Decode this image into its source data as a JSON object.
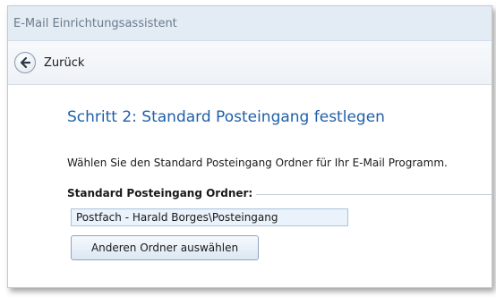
{
  "window": {
    "title": "E-Mail Einrichtungsassistent"
  },
  "nav": {
    "back_label": "Zurück",
    "back_icon": "arrow-left-icon"
  },
  "step": {
    "title": "Schritt 2: Standard Posteingang festlegen",
    "instruction": "Wählen Sie den Standard Posteingang Ordner für Ihr E-Mail Programm."
  },
  "folder_group": {
    "label": "Standard Posteingang Ordner:",
    "value": "Postfach - Harald Borges\\Posteingang",
    "choose_button_label": "Anderen Ordner auswählen"
  },
  "colors": {
    "title_text": "#6b7b8c",
    "step_title": "#1f5fa8",
    "input_bg": "#eaf2fb"
  }
}
